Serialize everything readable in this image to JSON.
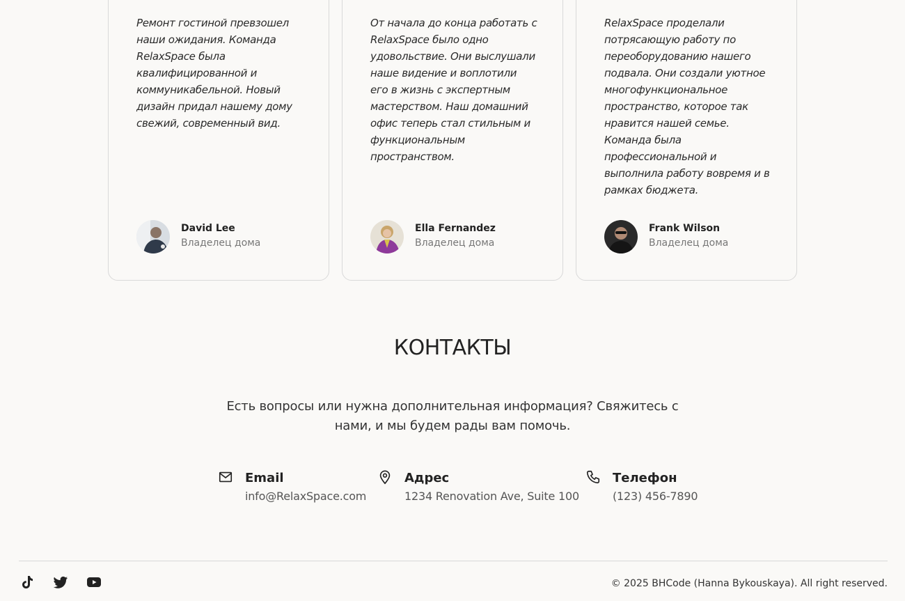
{
  "testimonials": [
    {
      "quote": "Ремонт гостиной превзошел наши ожидания. Команда RelaxSpace была квалифицированной и коммуникабельной. Новый дизайн придал нашему дому свежий, современный вид.",
      "name": "David Lee",
      "role": "Владелец дома"
    },
    {
      "quote": "От начала до конца работать с RelaxSpace было одно удовольствие. Они выслушали наше видение и воплотили его в жизнь с экспертным мастерством. Наш домашний офис теперь стал стильным и функциональным пространством.",
      "name": "Ella Fernandez",
      "role": "Владелец дома"
    },
    {
      "quote": "RelaxSpace проделали потрясающую работу по переоборудованию нашего подвала. Они создали уютное многофункциональное пространство, которое так нравится нашей семье. Команда была профессиональной и выполнила работу вовремя и в рамках бюджета.",
      "name": "Frank Wilson",
      "role": "Владелец дома"
    }
  ],
  "contacts": {
    "title": "КОНТАКТЫ",
    "intro": "Есть вопросы или нужна дополнительная информация? Свяжитесь с нами, и мы будем рады вам помочь.",
    "items": [
      {
        "label": "Email",
        "value": "info@RelaxSpace.com",
        "icon": "mail-icon"
      },
      {
        "label": "Адрес",
        "value": "1234 Renovation Ave, Suite 100",
        "icon": "map-pin-icon"
      },
      {
        "label": "Телефон",
        "value": "(123) 456-7890",
        "icon": "phone-icon"
      }
    ]
  },
  "footer": {
    "social": [
      "tiktok-icon",
      "twitter-icon",
      "youtube-icon"
    ],
    "copyright": "© 2025 BHCode (Hanna Bykouskaya). All right reserved."
  },
  "colors": {
    "background": "#faf9f7",
    "text": "#222222",
    "muted": "#777777",
    "border": "#d9d9d9"
  }
}
